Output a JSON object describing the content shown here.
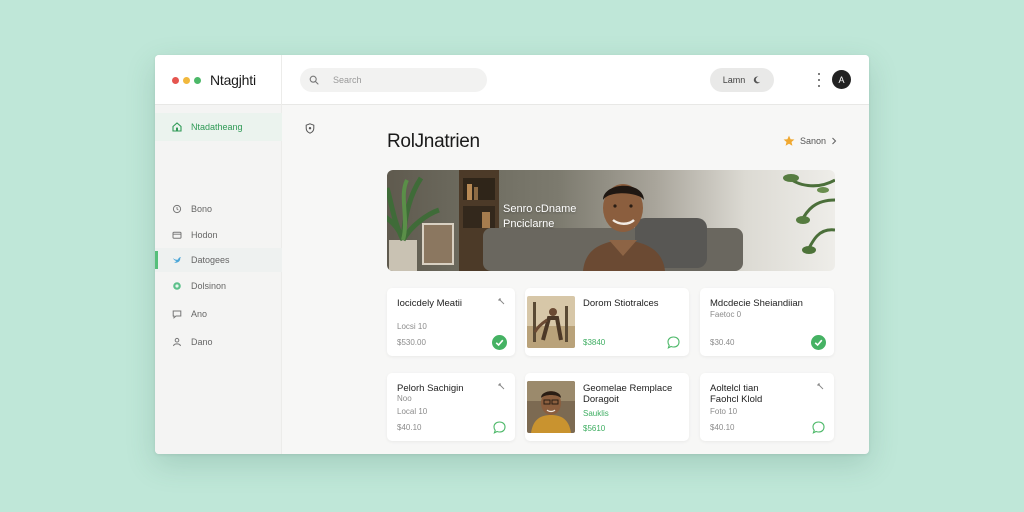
{
  "app": {
    "name": "Ntagjhti"
  },
  "search": {
    "placeholder": "Search"
  },
  "topbar": {
    "theme_label": "Lamn"
  },
  "user": {
    "initial": "A"
  },
  "sidebar": {
    "items": [
      {
        "label": "Ntadatheang",
        "icon": "home-icon"
      },
      {
        "label": "Bono",
        "icon": "clock-icon"
      },
      {
        "label": "Hodon",
        "icon": "folder-icon"
      },
      {
        "label": "Datogees",
        "icon": "bird-icon"
      },
      {
        "label": "Dolsinon",
        "icon": "circle-icon"
      },
      {
        "label": "Ano",
        "icon": "chat-icon"
      },
      {
        "label": "Dano",
        "icon": "person-icon"
      }
    ]
  },
  "main": {
    "title": "RolJnatrien",
    "star_link": "Sanon",
    "hero": {
      "line1": "Senro cDname",
      "line2": "Pnciclarne"
    },
    "cards": [
      {
        "title": "Iocicdely Meatii",
        "sub": "Locsi 10",
        "value": "$530.00"
      },
      {
        "title": "Dorom Stiotralces",
        "sub": "",
        "value": "$3840"
      },
      {
        "title": "Mdcdecie Sheiandiian",
        "sub": "Faetoc 0",
        "value": "$30.40"
      },
      {
        "title": "Pelorh Sachigin",
        "sub": "Noo",
        "sub2": "Local 10",
        "value": "$40.10"
      },
      {
        "title": "Geomelae Remplace",
        "title2": "Doragoit",
        "sub": "Sauklis",
        "value": "$5610"
      },
      {
        "title": "Aoltelcl tian",
        "title2": "Faohcl Klold",
        "sub": "Foto 10",
        "value": "$40.10"
      }
    ]
  },
  "colors": {
    "accent": "#3fae62",
    "dot_red": "#e5554f",
    "dot_yellow": "#f1b83d",
    "dot_green": "#4cb868",
    "star": "#f0a830"
  }
}
